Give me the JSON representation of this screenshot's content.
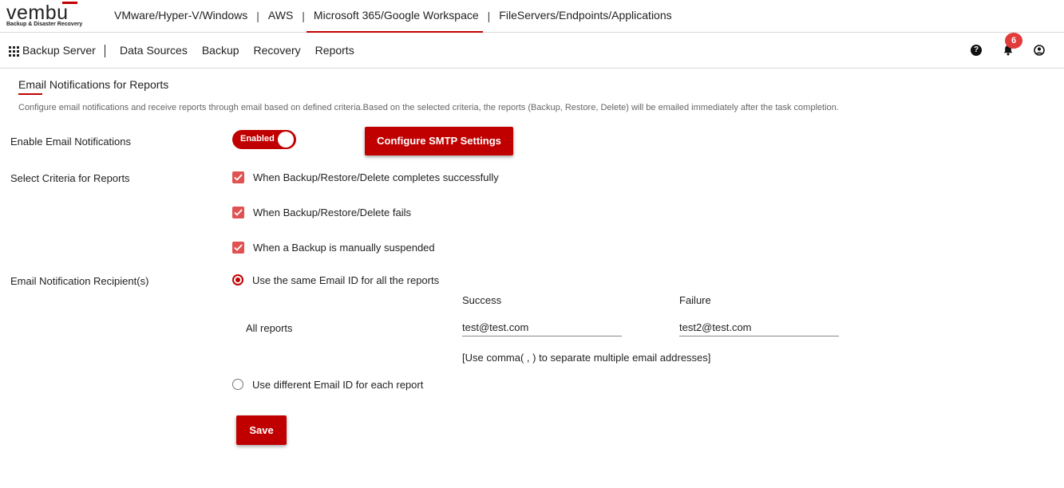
{
  "brand": {
    "logo_text": "vembu",
    "tagline": "Backup & Disaster Recovery",
    "accent": "#c00000"
  },
  "product_tabs": [
    {
      "label": "VMware/Hyper-V/Windows"
    },
    {
      "label": "AWS"
    },
    {
      "label": "Microsoft 365/Google Workspace",
      "active": true
    },
    {
      "label": "FileServers/Endpoints/Applications"
    }
  ],
  "nav": {
    "server_label": "Backup Server",
    "items": [
      "Data Sources",
      "Backup",
      "Recovery",
      "Reports"
    ],
    "notification_count": "6",
    "icons": [
      "grid-icon",
      "help-icon",
      "bell-icon",
      "user-icon"
    ]
  },
  "page": {
    "title": "Email Notifications for Reports",
    "description": "Configure email notifications and receive reports through email based on defined criteria.Based on the selected criteria, the reports (Backup, Restore, Delete) will be emailed immediately after the task completion."
  },
  "enable": {
    "label": "Enable Email Notifications",
    "toggle_text": "Enabled",
    "smtp_button": "Configure SMTP Settings"
  },
  "criteria": {
    "label": "Select Criteria for Reports",
    "options": [
      {
        "label": "When Backup/Restore/Delete completes successfully",
        "checked": true
      },
      {
        "label": "When Backup/Restore/Delete fails",
        "checked": true
      },
      {
        "label": "When a Backup is manually suspended",
        "checked": true
      }
    ]
  },
  "recipients": {
    "label": "Email Notification Recipient(s)",
    "same_option": "Use the same Email ID for all the reports",
    "different_option": "Use different Email ID for each report",
    "selected": "same",
    "success_header": "Success",
    "failure_header": "Failure",
    "row_label": "All reports",
    "success_value": "test@test.com",
    "failure_value": "test2@test.com",
    "hint": "[Use comma( , ) to separate multiple email addresses]"
  },
  "save_label": "Save"
}
